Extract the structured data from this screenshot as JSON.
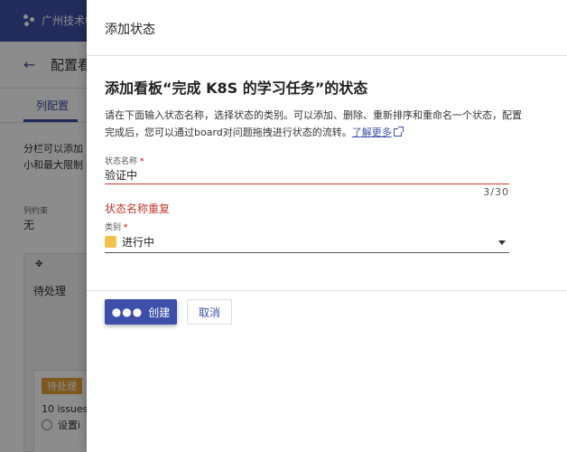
{
  "background": {
    "brand": "广州技术中",
    "page_title": "配置看",
    "tab": "列配置",
    "description_line1": "分栏可以添加",
    "description_line2": "小和最大限制",
    "constraint_label": "列约束",
    "constraint_value": "无",
    "column_name": "待处理",
    "badge": "待处理",
    "issues": "10 issues",
    "radio_label": "设置i"
  },
  "dialog": {
    "title": "添加状态",
    "heading": "添加看板“完成 K8S 的学习任务”的状态",
    "description": "请在下面输入状态名称，选择状态的类别。可以添加、删除、重新排序和重命名一个状态，配置完成后，您可以通过board对问题拖拽进行状态的流转。",
    "learn_more": "了解更多",
    "name_field": {
      "label": "状态名称",
      "required_mark": "*",
      "value": "验证中",
      "counter": "3/30",
      "error": "状态名称重复"
    },
    "category_field": {
      "label": "类别",
      "required_mark": "*",
      "value": "进行中",
      "swatch_color": "#f2c14e"
    },
    "buttons": {
      "create_dots": "●●●",
      "create": "创建",
      "cancel": "取消"
    }
  },
  "colors": {
    "primary": "#3d4fa8",
    "error": "#c0392b",
    "badge": "#e3a23a"
  }
}
